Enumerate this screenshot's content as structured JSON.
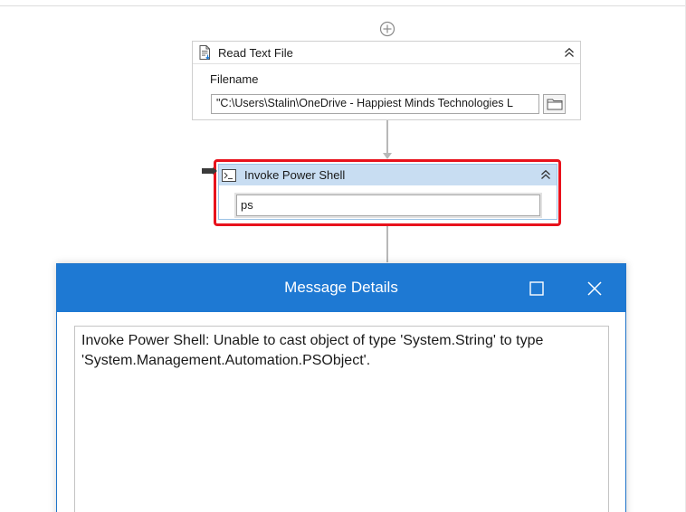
{
  "workflow": {
    "add_activity_icon": "plus-circle-icon",
    "read_text_file": {
      "title": "Read Text File",
      "icon": "document-icon",
      "filename_label": "Filename",
      "filename_value": "\"C:\\Users\\Stalin\\OneDrive - Happiest Minds Technologies L",
      "browse_icon": "folder-icon",
      "collapse_icon": "double-chevron-up-icon"
    },
    "invoke_power_shell": {
      "title": "Invoke Power Shell",
      "icon": "terminal-icon",
      "command_value": "ps",
      "collapse_icon": "double-chevron-up-icon",
      "highlight_color": "#e8121c",
      "header_color": "#c8ddf2"
    }
  },
  "dialog": {
    "title": "Message Details",
    "titlebar_color": "#1e79d3",
    "message": "Invoke Power Shell: Unable to cast object of type 'System.String' to type 'System.Management.Automation.PSObject'."
  }
}
